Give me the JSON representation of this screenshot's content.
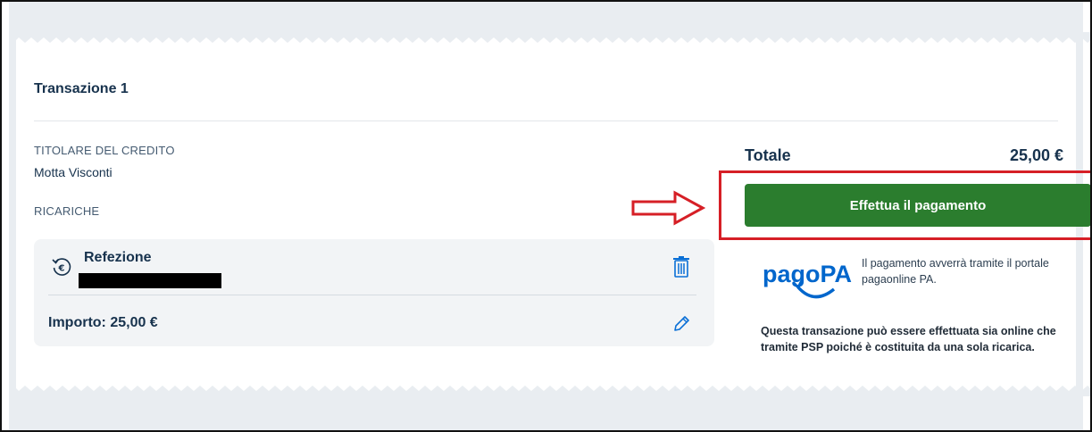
{
  "transaction": {
    "title": "Transazione 1",
    "creditor_label": "TITOLARE DEL CREDITO",
    "creditor_value": "Motta Visconti",
    "recharges_label": "RICARICHE"
  },
  "item": {
    "name": "Refezione",
    "amount_text": "Importo: 25,00 €",
    "icon": "euro-refresh-icon"
  },
  "summary": {
    "total_label": "Totale",
    "total_value": "25,00 €",
    "pay_button_label": "Effettua il pagamento"
  },
  "pagopa": {
    "logo_text": "pagoPA",
    "note": "Il pagamento avverrà tramite il portale pagaonline PA."
  },
  "transaction_note": "Questa transazione può essere effettuata sia online che tramite PSP poiché è costituita da una sola ricarica.",
  "colors": {
    "pay_button": "#2b7d2e",
    "highlight": "#d61f26",
    "heading": "#17324d",
    "pagopa_blue": "#0066cc"
  }
}
